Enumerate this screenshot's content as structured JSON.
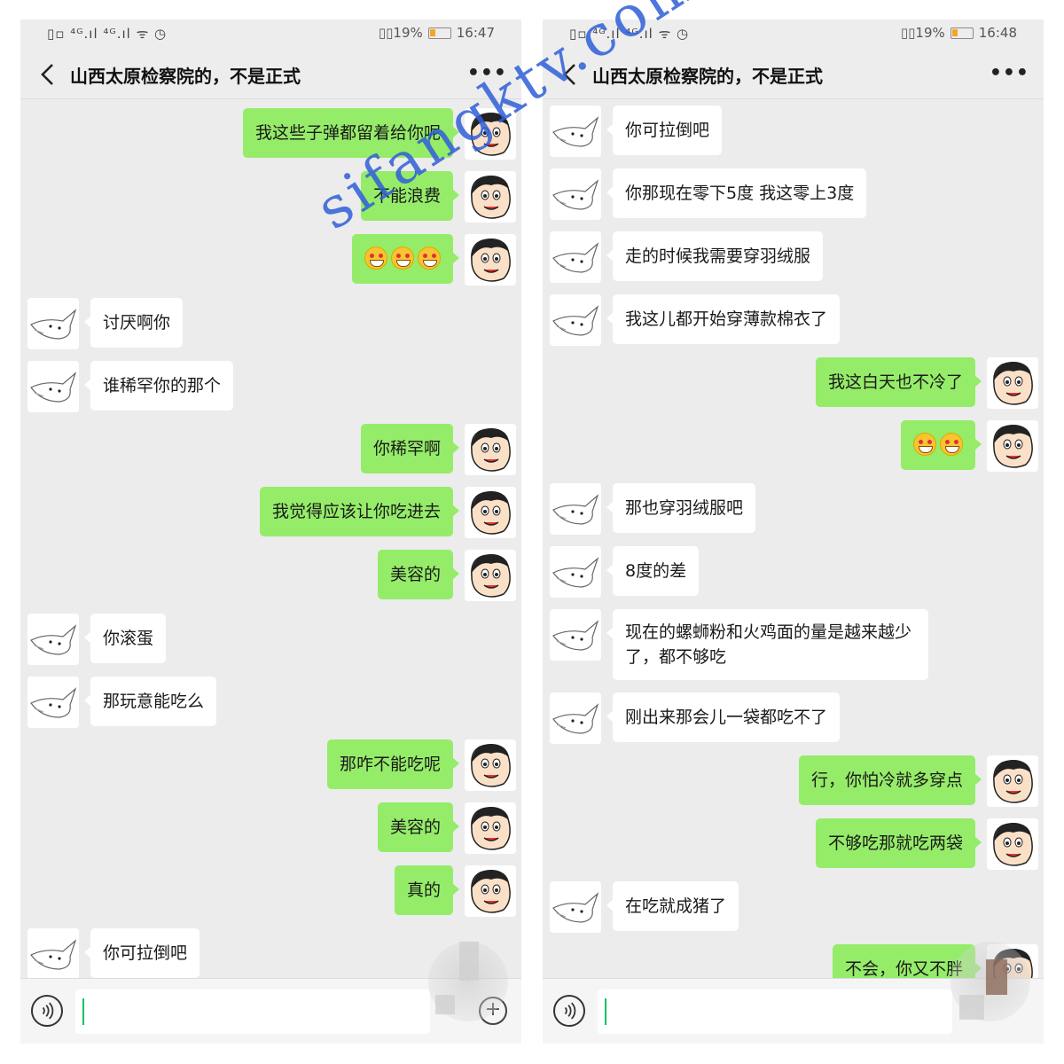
{
  "left_screen": {
    "status": {
      "signal_text": "▯▫ ⁴ᴳ.ıl ⁴ᴳ.ıl ᯤ ◷",
      "battery_text": "▯▯19%",
      "time": "16:47"
    },
    "title": "山西太原检察院的，不是正式",
    "more": "•••",
    "messages": [
      {
        "side": "out",
        "text": "我这些子弹都留着给你呢"
      },
      {
        "side": "out",
        "text": "不能浪费"
      },
      {
        "side": "out",
        "text": "",
        "emoji_count": 3
      },
      {
        "side": "in",
        "text": "讨厌啊你"
      },
      {
        "side": "in",
        "text": "谁稀罕你的那个"
      },
      {
        "side": "out",
        "text": "你稀罕啊"
      },
      {
        "side": "out",
        "text": "我觉得应该让你吃进去"
      },
      {
        "side": "out",
        "text": "美容的"
      },
      {
        "side": "in",
        "text": "你滚蛋"
      },
      {
        "side": "in",
        "text": "那玩意能吃么"
      },
      {
        "side": "out",
        "text": "那咋不能吃呢"
      },
      {
        "side": "out",
        "text": "美容的"
      },
      {
        "side": "out",
        "text": "真的"
      },
      {
        "side": "in",
        "text": "你可拉倒吧"
      }
    ],
    "plus": "+"
  },
  "right_screen": {
    "status": {
      "signal_text": "▯▫ ⁴ᴳ.ıl ⁴ᴳ.ıl ᯤ ◷",
      "battery_text": "▯▯19%",
      "time": "16:48"
    },
    "title": "山西太原检察院的，不是正式",
    "more": "•••",
    "messages": [
      {
        "side": "in",
        "text": "你可拉倒吧"
      },
      {
        "side": "in",
        "text": "你那现在零下5度 我这零上3度"
      },
      {
        "side": "in",
        "text": "走的时候我需要穿羽绒服"
      },
      {
        "side": "in",
        "text": "我这儿都开始穿薄款棉衣了"
      },
      {
        "side": "out",
        "text": "我这白天也不冷了"
      },
      {
        "side": "out",
        "text": "",
        "emoji_count": 2
      },
      {
        "side": "in",
        "text": "那也穿羽绒服吧"
      },
      {
        "side": "in",
        "text": "8度的差"
      },
      {
        "side": "in",
        "text": "现在的螺蛳粉和火鸡面的量是越来越少了，都不够吃"
      },
      {
        "side": "in",
        "text": "刚出来那会儿一袋都吃不了"
      },
      {
        "side": "out",
        "text": "行，你怕冷就多穿点"
      },
      {
        "side": "out",
        "text": "不够吃那就吃两袋"
      },
      {
        "side": "in",
        "text": "在吃就成猪了"
      },
      {
        "side": "out",
        "text": "不会，你又不胖"
      }
    ]
  },
  "watermark": "sifangktv.com",
  "icons": [
    "back-icon",
    "more-icon",
    "voice-icon",
    "plus-icon",
    "battery-icon",
    "wifi-icon",
    "alarm-icon"
  ],
  "colors": {
    "out_bubble": "#95ec69",
    "in_bubble": "#ffffff",
    "chat_bg": "#ececec",
    "watermark": "#2f5fd8",
    "caret": "#07c160"
  }
}
